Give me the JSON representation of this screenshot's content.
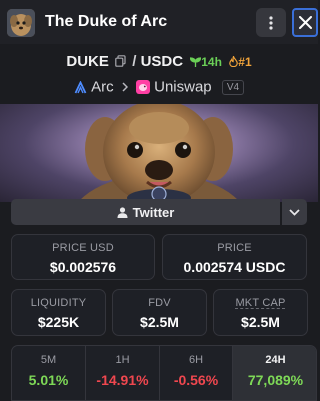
{
  "header": {
    "title": "The Duke of Arc"
  },
  "pair": {
    "base": "DUKE",
    "separator": "/",
    "quote": "USDC",
    "age": "14h",
    "rank": "#1"
  },
  "chain": {
    "network": "Arc",
    "dex": "Uniswap",
    "version": "V4"
  },
  "socials": {
    "primary_label": "Twitter"
  },
  "price": {
    "usd_label": "PRICE USD",
    "usd_value": "$0.002576",
    "native_label": "PRICE",
    "native_value": "0.002574 USDC"
  },
  "stats": [
    {
      "label": "LIQUIDITY",
      "value": "$225K"
    },
    {
      "label": "FDV",
      "value": "$2.5M"
    },
    {
      "label": "MKT CAP",
      "value": "$2.5M"
    }
  ],
  "timeframes": [
    {
      "label": "5M",
      "value": "5.01%",
      "direction": "up"
    },
    {
      "label": "1H",
      "value": "-14.91%",
      "direction": "down"
    },
    {
      "label": "6H",
      "value": "-0.56%",
      "direction": "down"
    },
    {
      "label": "24H",
      "value": "77,089%",
      "direction": "up",
      "active": true
    }
  ],
  "colors": {
    "positive": "#7ed957",
    "negative": "#f0474f",
    "accent_focus": "#3a6fd8",
    "age": "#6bcf57",
    "rank": "#f0a33a"
  }
}
